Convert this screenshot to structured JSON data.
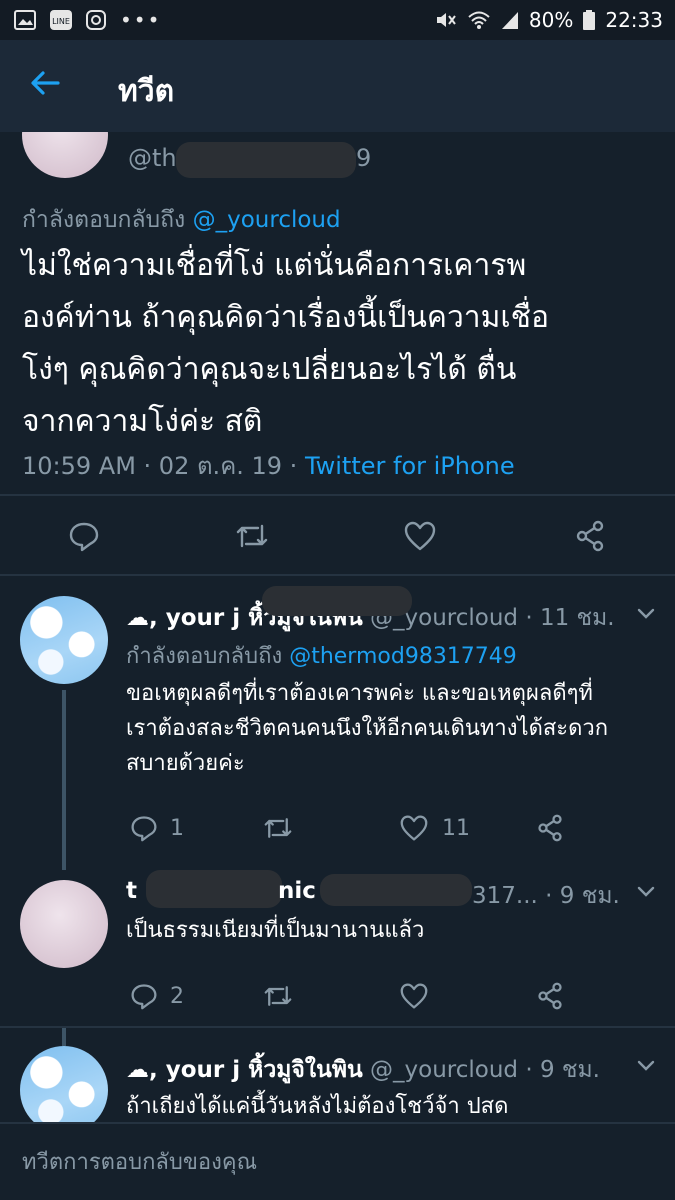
{
  "status": {
    "battery": "80%",
    "time": "22:33"
  },
  "appbar": {
    "title": "ทวีต"
  },
  "main_tweet": {
    "handle": "@th",
    "handle_end": "9",
    "replying_prefix": "กำลังตอบกลับถึง",
    "replying_to": "@_yourcloud",
    "lines": [
      "ไม่ใช่ความเชื่อที่โง่ แต่นั่นคือการเคารพ",
      "องค์ท่าน ถ้าคุณคิดว่าเรื่องนี้เป็นความเชื่อ",
      "โง่ๆ คุณคิดว่าคุณจะเปลี่ยนอะไรได้ ตื่น",
      "จากความโง่ค่ะ สติ"
    ],
    "meta_time": "10:59 AM · 02 ต.ค. 19 ·",
    "meta_source": "Twitter for iPhone"
  },
  "replies": [
    {
      "name": "☁, your j หิ้วมูจิในพิน",
      "handle": "@_yourcloud · 11 ชม.",
      "replying_prefix": "กำลังตอบกลับถึง",
      "replying_to": "@thermod98317749",
      "lines": [
        "ขอเหตุผลดีๆที่เราต้องเคารพค่ะ และขอเหตุผลดีๆที่",
        "เราต้องสละชีวิตคนคนนึงให้อีกคนเดินทางได้สะดวก",
        "สบายด้วยค่ะ"
      ],
      "reply_count": "1",
      "like_count": "11"
    },
    {
      "name": "t",
      "name_end": "nic",
      "handle": "317... · 9 ชม.",
      "lines": [
        "เป็นธรรมเนียมที่เป็นมานานแล้ว"
      ],
      "reply_count": "2",
      "like_count": ""
    },
    {
      "name": "☁, your j หิ้วมูจิในพิน",
      "handle": "@_yourcloud · 9 ชม.",
      "lines": [
        "ถ้าเถียงได้แค่นี้วันหลังไม่ต้องโชว์จ้า ปสด"
      ]
    }
  ],
  "reply_input": {
    "placeholder": "ทวีตการตอบกลับของคุณ"
  },
  "colors": {
    "background": "#15202b",
    "accent": "#1da1f2",
    "muted": "#8899a6"
  },
  "icons": [
    "image-icon",
    "line-icon",
    "instagram-icon",
    "more-icon",
    "mute-icon",
    "wifi-icon",
    "signal-icon",
    "battery-icon",
    "back-arrow-icon",
    "reply-icon",
    "retweet-icon",
    "like-icon",
    "share-icon",
    "chevron-down-icon"
  ]
}
